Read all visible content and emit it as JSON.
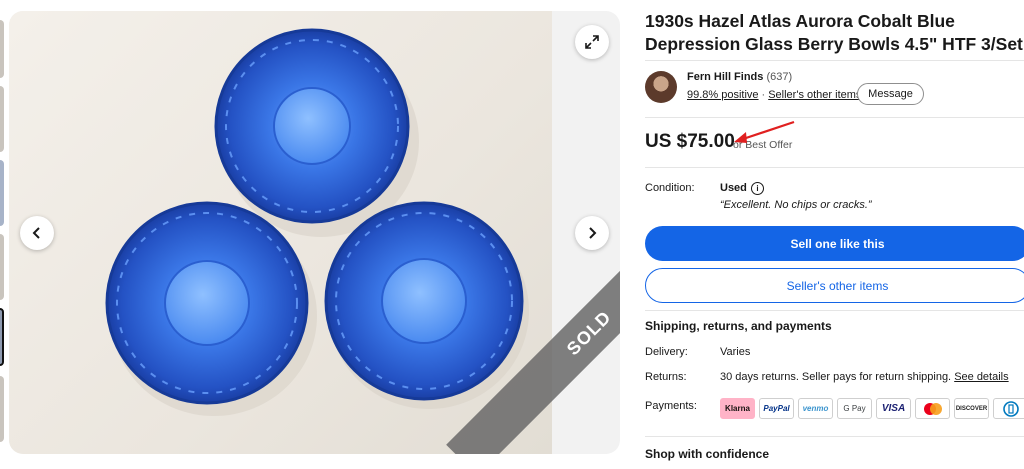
{
  "listing": {
    "title": "1930s Hazel Atlas Aurora Cobalt Blue Depression Glass Berry Bowls 4.5\" HTF 3/Set",
    "sold_badge": "SOLD"
  },
  "seller": {
    "name": "Fern Hill Finds",
    "feedback_count": "(637)",
    "positive": "99.8% positive",
    "separator": "·",
    "other_items_link": "Seller's other items",
    "message_label": "Message"
  },
  "price": {
    "amount": "US $75.00",
    "best_offer": "or Best Offer"
  },
  "condition": {
    "label": "Condition:",
    "value": "Used",
    "info_icon": "i",
    "description": "“Excellent. No chips or cracks.”"
  },
  "actions": {
    "sell_one_like_this": "Sell one like this",
    "sellers_other_items": "Seller's other items"
  },
  "shipping": {
    "heading": "Shipping, returns, and payments",
    "delivery_label": "Delivery:",
    "delivery_value": "Varies",
    "returns_label": "Returns:",
    "returns_value": "30 days returns. Seller pays for return shipping.",
    "see_details": "See details",
    "payments_label": "Payments:",
    "methods": [
      "Klarna",
      "PayPal",
      "venmo",
      "G Pay",
      "VISA",
      "Mastercard",
      "DISCOVER",
      "Diners Club"
    ]
  },
  "confidence": {
    "heading": "Shop with confidence"
  },
  "icons": {
    "prev": "chevron-left-icon",
    "next": "chevron-right-icon",
    "expand": "expand-icon",
    "annotation_arrow": "red-arrow-annotation"
  },
  "colors": {
    "primary_blue": "#1465e6",
    "bowl_blue": "#2f5fd0",
    "annotation_red": "#e02020"
  }
}
